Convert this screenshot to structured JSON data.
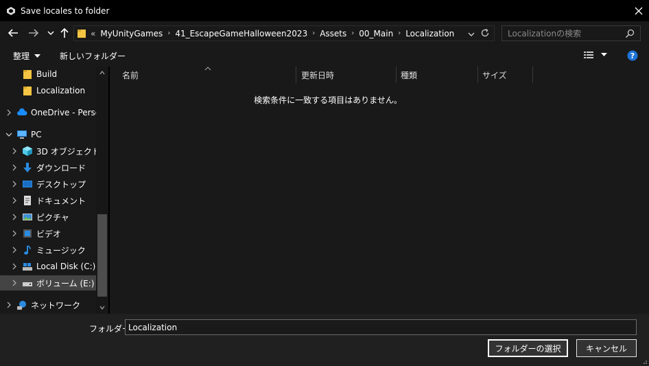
{
  "window": {
    "title": "Save locales to folder"
  },
  "address": {
    "overflow": "«",
    "crumbs": [
      "MyUnityGames",
      "41_EscapeGameHalloween2023",
      "Assets",
      "00_Main",
      "Localization"
    ]
  },
  "search": {
    "placeholder": "Localizationの検索"
  },
  "toolbar": {
    "organize": "整理",
    "new_folder": "新しいフォルダー"
  },
  "nav": {
    "items": [
      {
        "label": "Build",
        "icon": "folder-icon"
      },
      {
        "label": "Localization",
        "icon": "folder-icon"
      },
      {
        "label": "OneDrive - Persor",
        "icon": "cloud-icon"
      },
      {
        "label": "PC",
        "icon": "pc-icon"
      },
      {
        "label": "3D オブジェクト",
        "icon": "cube-icon"
      },
      {
        "label": "ダウンロード",
        "icon": "download-icon"
      },
      {
        "label": "デスクトップ",
        "icon": "desktop-icon"
      },
      {
        "label": "ドキュメント",
        "icon": "document-icon"
      },
      {
        "label": "ピクチャ",
        "icon": "picture-icon"
      },
      {
        "label": "ビデオ",
        "icon": "video-icon"
      },
      {
        "label": "ミュージック",
        "icon": "music-icon"
      },
      {
        "label": "Local Disk (C:)",
        "icon": "disk-icon"
      },
      {
        "label": "ボリューム (E:)",
        "icon": "drive-icon"
      },
      {
        "label": "ネットワーク",
        "icon": "network-icon"
      }
    ]
  },
  "columns": {
    "name": "名前",
    "date": "更新日時",
    "type": "種類",
    "size": "サイズ"
  },
  "empty_message": "検索条件に一致する項目はありません。",
  "folder": {
    "label": "フォルダー:",
    "value": "Localization"
  },
  "buttons": {
    "select": "フォルダーの選択",
    "cancel": "キャンセル"
  }
}
